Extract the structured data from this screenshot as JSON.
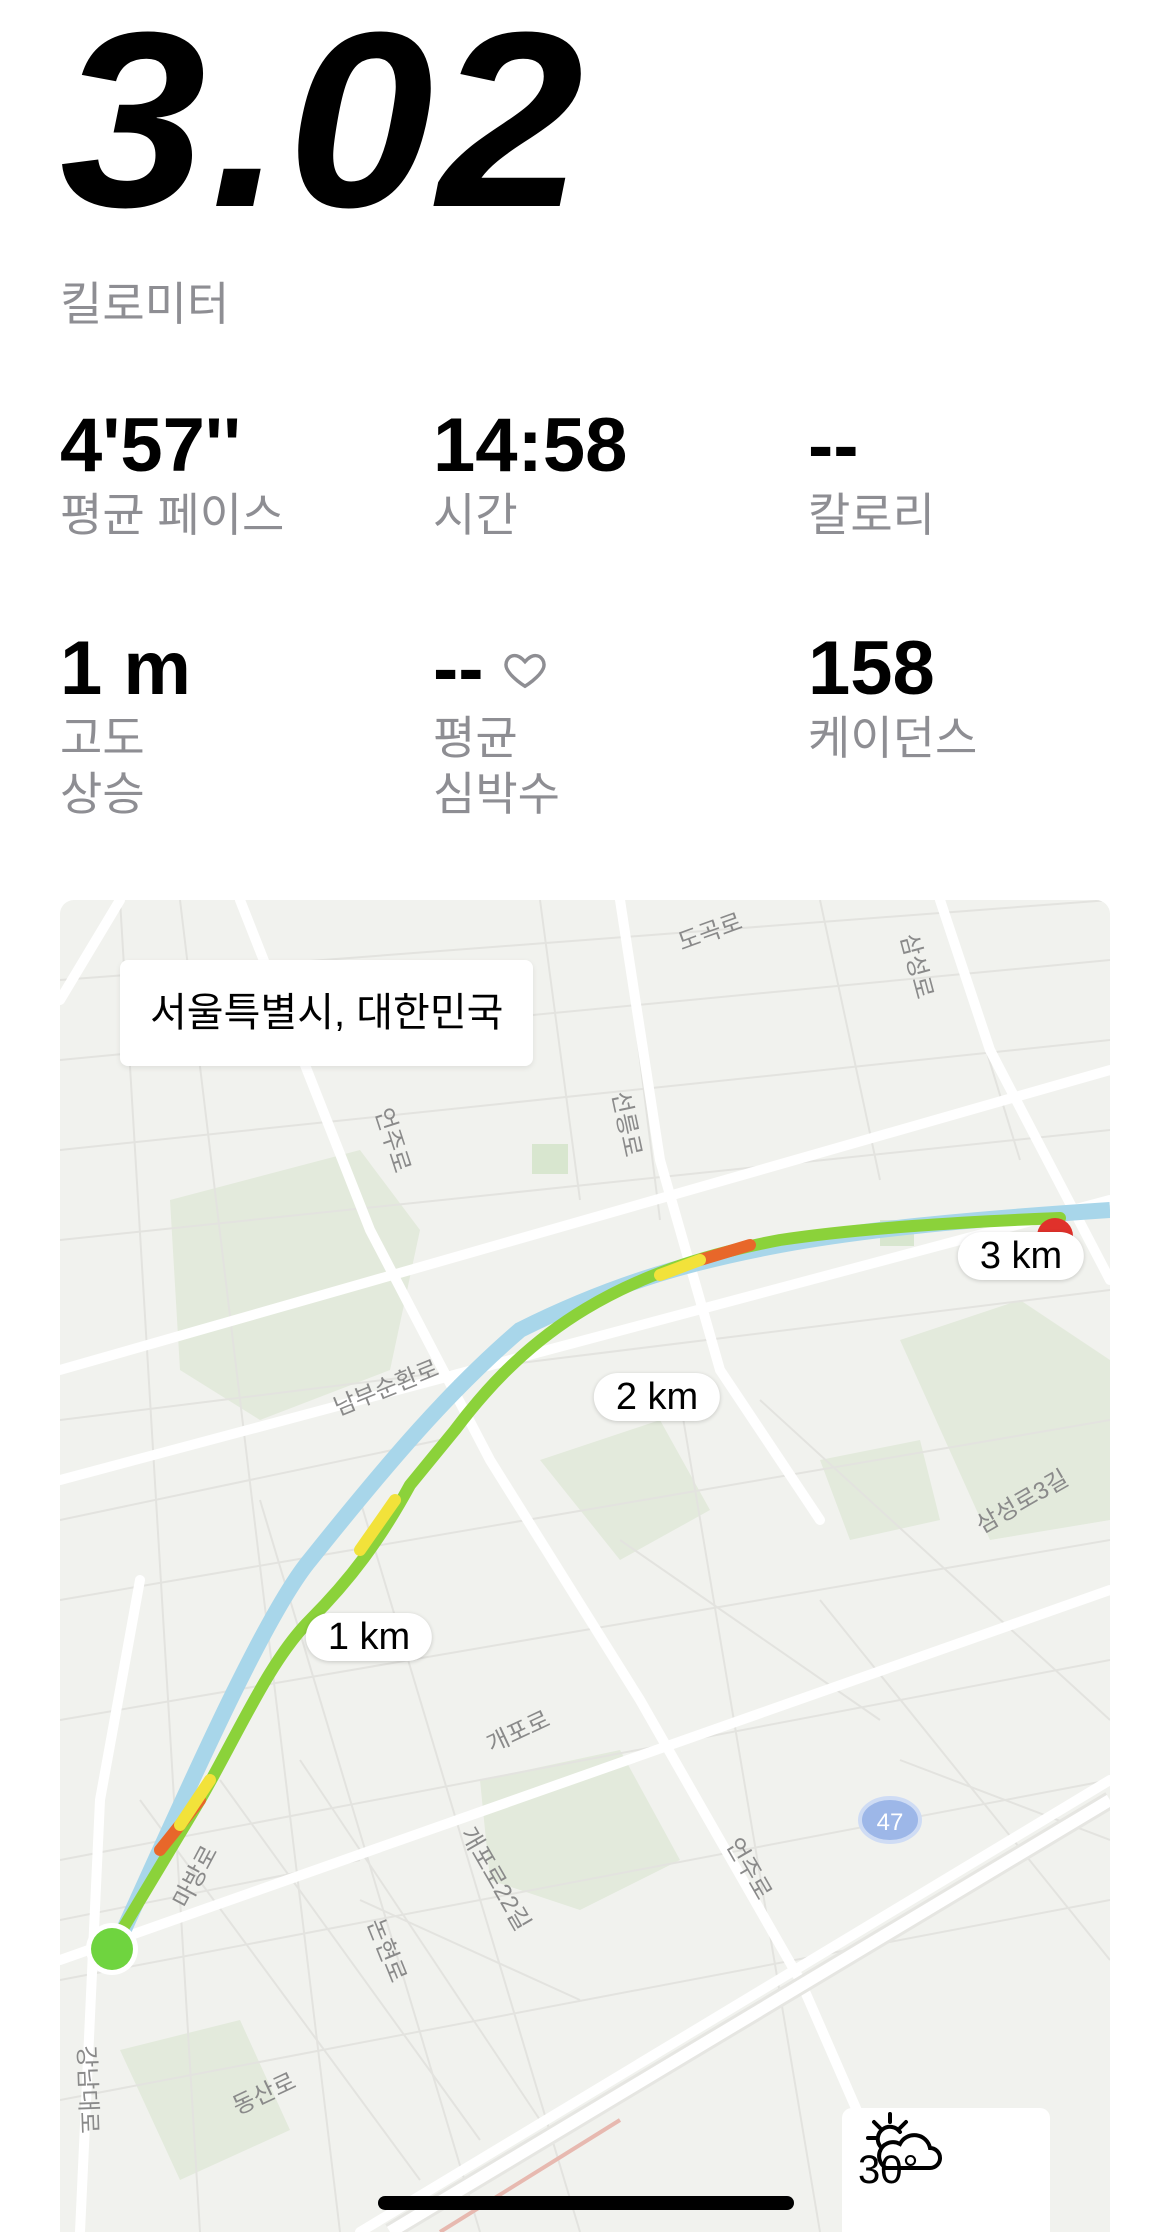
{
  "summary": {
    "distance": "3.02",
    "distance_unit": "킬로미터"
  },
  "stats": {
    "pace": {
      "value": "4'57''",
      "label": "평균 페이스"
    },
    "time": {
      "value": "14:58",
      "label": "시간"
    },
    "calories": {
      "value": "--",
      "label": "칼로리"
    },
    "elevation": {
      "value": "1 m",
      "label_line1": "고도",
      "label_line2": "상승"
    },
    "heart_rate": {
      "value": "--",
      "label_line1": "평균",
      "label_line2": "심박수",
      "icon": "heart-outline-icon"
    },
    "cadence": {
      "value": "158",
      "label": "케이던스"
    }
  },
  "map": {
    "location": "서울특별시, 대한민국",
    "markers": [
      "1 km",
      "2 km",
      "3 km"
    ],
    "roads": [
      "도곡로",
      "삼성로",
      "언주로",
      "선릉로",
      "남부순환로",
      "삼성로3길",
      "개포로",
      "언주로",
      "개포로22길",
      "논현로",
      "마방로",
      "강남대로",
      "동산로"
    ],
    "route_badge": "47",
    "colors": {
      "route": "#8bd23a",
      "start": "#6fd43f",
      "end": "#e0312b",
      "fast": "#f2e23a",
      "slow": "#e8672a"
    }
  },
  "weather": {
    "temperature": "30°",
    "icon": "partly-sunny-icon"
  }
}
